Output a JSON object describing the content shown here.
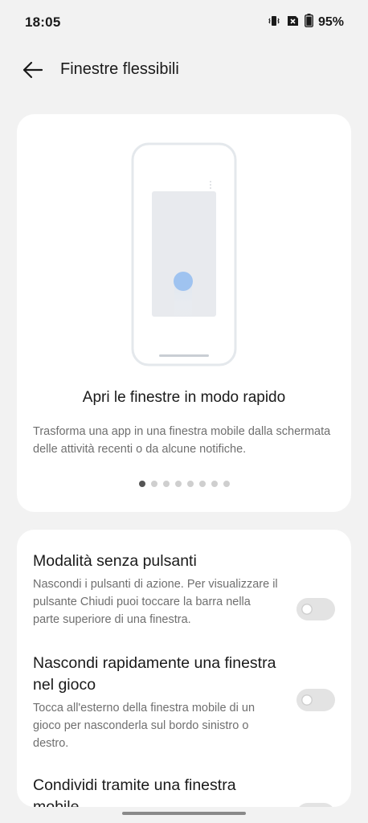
{
  "status": {
    "time": "18:05",
    "battery": "95%",
    "icons": [
      "vibrate-icon",
      "sim-off-icon",
      "battery-icon"
    ]
  },
  "header": {
    "title": "Finestre flessibili",
    "back_icon": "arrow-left-icon"
  },
  "intro": {
    "title": "Apri le finestre in modo rapido",
    "description": "Trasforma una app in una finestra mobile dalla schermata delle attività recenti o da alcune notifiche.",
    "page_count": 8,
    "active_page": 1
  },
  "settings": [
    {
      "title": "Modalità senza pulsanti",
      "description": "Nascondi i pulsanti di azione. Per visualizzare il pulsante Chiudi puoi toccare la barra nella parte superiore di una finestra.",
      "enabled": false
    },
    {
      "title": "Nascondi rapidamente una finestra nel gioco",
      "description": "Tocca all'esterno della finestra mobile di un gioco per nasconderla sul bordo sinistro o destro.",
      "enabled": false
    },
    {
      "title": "Condividi tramite una finestra mobile",
      "description": "",
      "enabled": false
    }
  ],
  "colors": {
    "background": "#f2f2f2",
    "card": "#ffffff",
    "accent_blue": "#9fc3f0",
    "toggle_off": "#e3e3e3"
  }
}
